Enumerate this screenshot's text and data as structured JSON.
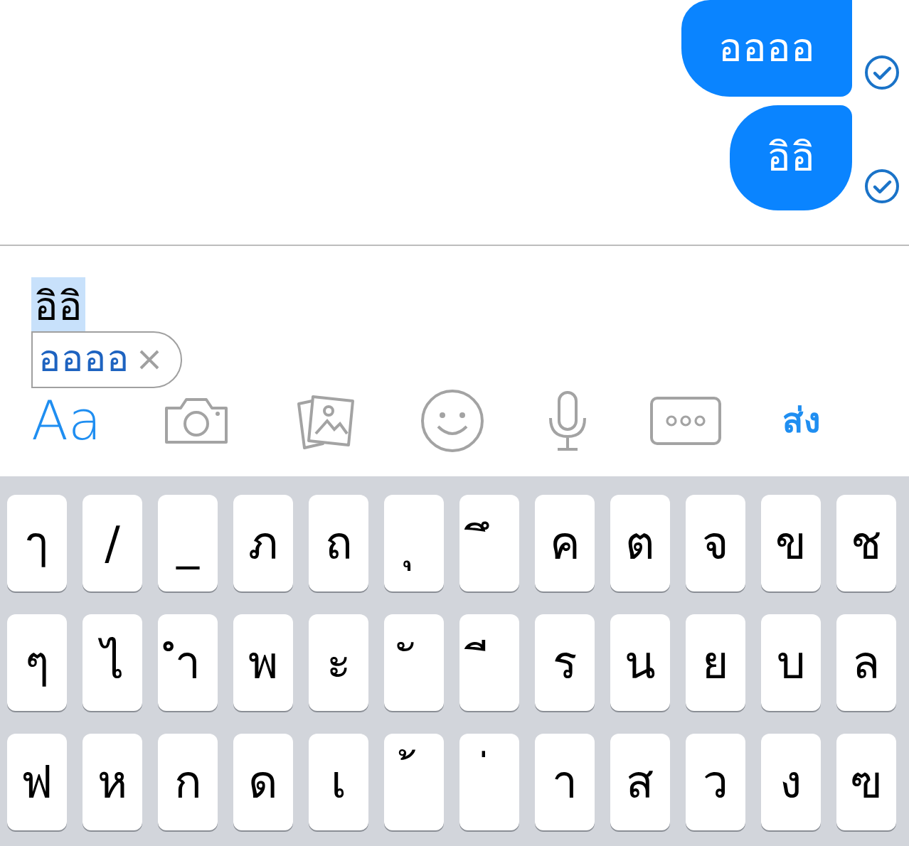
{
  "messages": [
    {
      "text": "ออออ",
      "read": true
    },
    {
      "text": "อิอิ",
      "read": true
    }
  ],
  "composer": {
    "value": "อิอิ",
    "selected": true
  },
  "suggestion": {
    "text": "ออออ",
    "dismissible": true
  },
  "toolbar": [
    {
      "kind": "text",
      "label": "Aa"
    },
    {
      "kind": "camera"
    },
    {
      "kind": "photos"
    },
    {
      "kind": "emoji"
    },
    {
      "kind": "mic"
    },
    {
      "kind": "more"
    },
    {
      "kind": "send",
      "label": "ส่ง"
    }
  ],
  "keyboard": {
    "rows": [
      [
        "ๅ",
        "/",
        "_",
        "ภ",
        "ถ",
        "ุ",
        "ึ",
        "ค",
        "ต",
        "จ",
        "ข",
        "ช"
      ],
      [
        "ๆ",
        "ไ",
        "ำ",
        "พ",
        "ะ",
        "ั",
        "ี",
        "ร",
        "น",
        "ย",
        "บ",
        "ล"
      ],
      [
        "ฟ",
        "ห",
        "ก",
        "ด",
        "เ",
        "้",
        "่",
        "า",
        "ส",
        "ว",
        "ง",
        "ฃ"
      ]
    ]
  }
}
